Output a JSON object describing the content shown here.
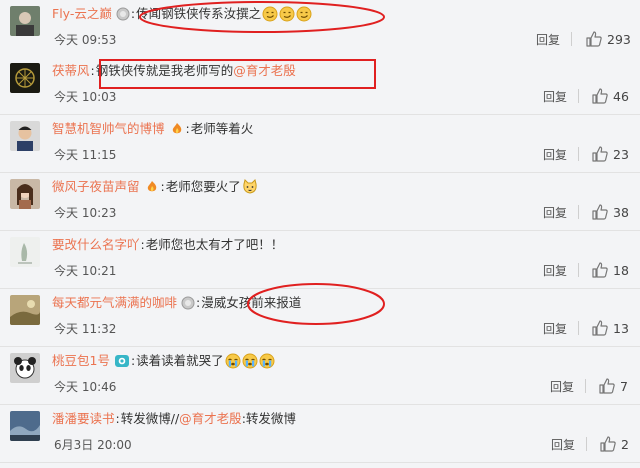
{
  "comments": [
    {
      "user": "Fly-云之巅",
      "badge": "silver-medal-icon",
      "colon": ":",
      "pre": "传闻钢铁侠传系汝撰之",
      "mention": "",
      "post": "",
      "emojis": [
        "smirk-emoji-icon",
        "smirk-emoji-icon",
        "smirk-emoji-icon"
      ],
      "time": "今天 09:53",
      "reply": "回复",
      "likes": "293"
    },
    {
      "user": "茯蒂风",
      "badge": "",
      "colon": ":",
      "pre": "钢铁侠传就是我老师写的",
      "mention": "@育才老殷",
      "post": "",
      "emojis": [],
      "time": "今天 10:03",
      "reply": "回复",
      "likes": "46"
    },
    {
      "user": "智慧机智帅气的博博",
      "badge": "fire-badge-icon",
      "colon": ":",
      "pre": "老师等着火",
      "mention": "",
      "post": "",
      "emojis": [],
      "time": "今天 11:15",
      "reply": "回复",
      "likes": "23"
    },
    {
      "user": "微风子夜苗声留",
      "badge": "fire-badge-icon",
      "colon": ":",
      "pre": "老师您要火了",
      "mention": "",
      "post": "",
      "emojis": [
        "cat-emoji-icon"
      ],
      "time": "今天 10:23",
      "reply": "回复",
      "likes": "38"
    },
    {
      "user": "要改什么名字吖",
      "badge": "",
      "colon": ":",
      "pre": "老师您也太有才了吧！！",
      "mention": "",
      "post": "",
      "emojis": [],
      "time": "今天 10:21",
      "reply": "回复",
      "likes": "18"
    },
    {
      "user": "每天都元气满满的咖啡",
      "badge": "silver-medal-icon",
      "colon": ":",
      "pre": "漫威女孩前来报道",
      "mention": "",
      "post": "",
      "emojis": [],
      "time": "今天 11:32",
      "reply": "回复",
      "likes": "13"
    },
    {
      "user": "桃豆包1号",
      "badge": "vip-badge-icon",
      "colon": ":",
      "pre": "读着读着就哭了",
      "mention": "",
      "post": "",
      "emojis": [
        "crying-emoji-icon",
        "crying-emoji-icon",
        "crying-emoji-icon"
      ],
      "time": "今天 10:46",
      "reply": "回复",
      "likes": "7"
    },
    {
      "user": "潘潘要读书",
      "badge": "",
      "colon": ":",
      "pre": "转发微博//",
      "mention": "@育才老殷",
      "post": ":转发微博",
      "emojis": [],
      "time": "6月3日 20:00",
      "reply": "回复",
      "likes": "2"
    }
  ],
  "colors": {
    "username": "#eb7350",
    "highlight": "#e02020"
  }
}
